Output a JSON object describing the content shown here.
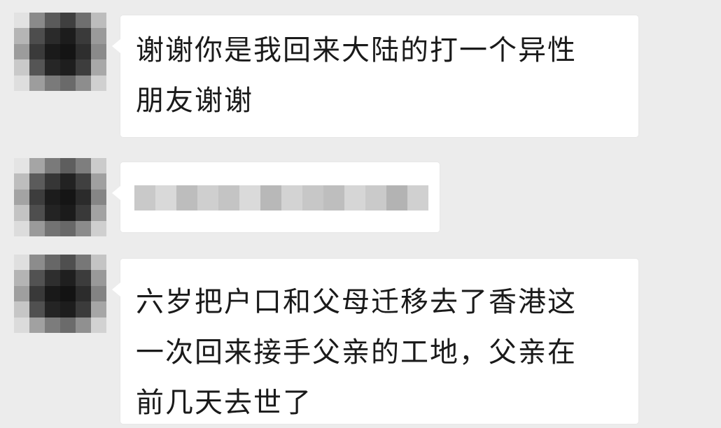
{
  "messages": [
    {
      "text": "谢谢你是我回来大陆的打一个异性\n朋友谢谢"
    },
    {
      "text": ""
    },
    {
      "text": "六岁把户口和父母迁移去了香港这\n一次回来接手父亲的工地，父亲在\n前几天去世了"
    }
  ],
  "colors": {
    "background": "#ececec",
    "bubble": "#ffffff",
    "text": "#1a1a1a"
  },
  "icons": {
    "avatar": "pixelated-avatar-icon"
  }
}
